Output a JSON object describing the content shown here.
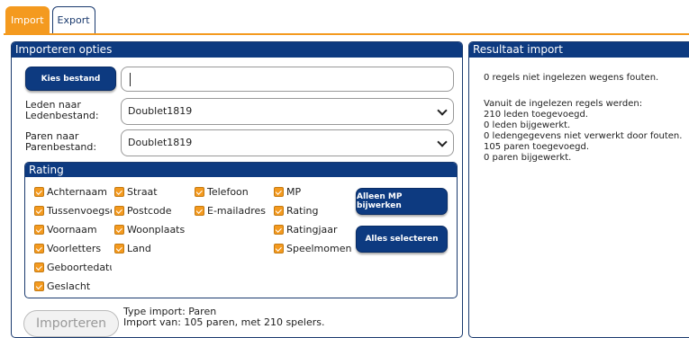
{
  "tabs": [
    {
      "label": "Import",
      "active": true
    },
    {
      "label": "Export",
      "active": false
    }
  ],
  "options_panel": {
    "title": "Importeren opties",
    "choose_file_label": "Kies bestand",
    "file_value": "",
    "leden_label_line1": "Leden naar",
    "leden_label_line2": "Ledenbestand:",
    "leden_select_value": "Doublet1819",
    "paren_label_line1": "Paren naar",
    "paren_label_line2": "Parenbestand:",
    "paren_select_value": "Doublet1819"
  },
  "rating": {
    "title": "Rating",
    "col1": [
      "Achternaam",
      "Tussenvoegsel",
      "Voornaam",
      "Voorletters",
      "Geboortedatum",
      "Geslacht"
    ],
    "col2": [
      "Straat",
      "Postcode",
      "Woonplaats",
      "Land"
    ],
    "col3": [
      "Telefoon",
      "E-mailadres"
    ],
    "col4": [
      "MP",
      "Rating",
      "Ratingjaar",
      "Speelmomenten"
    ],
    "btn_mp_only": "Alleen MP bijwerken",
    "btn_select_all": "Alles selecteren"
  },
  "import_button_label": "Importeren",
  "import_info": {
    "type": "Type import: Paren",
    "summary": "Import van: 105 paren, met 210 spelers."
  },
  "result_panel": {
    "title": "Resultaat import",
    "errors_line": "0 regels niet ingelezen wegens fouten.",
    "lines": [
      "Vanuit de ingelezen regels werden:",
      "210 leden toegevoegd.",
      "0 leden bijgewerkt.",
      "0 ledengegevens niet verwerkt door fouten.",
      "105 paren toegevoegd.",
      "0 paren bijgewerkt."
    ]
  },
  "colors": {
    "accent": "#f49a1f",
    "primary": "#0d3a80"
  }
}
